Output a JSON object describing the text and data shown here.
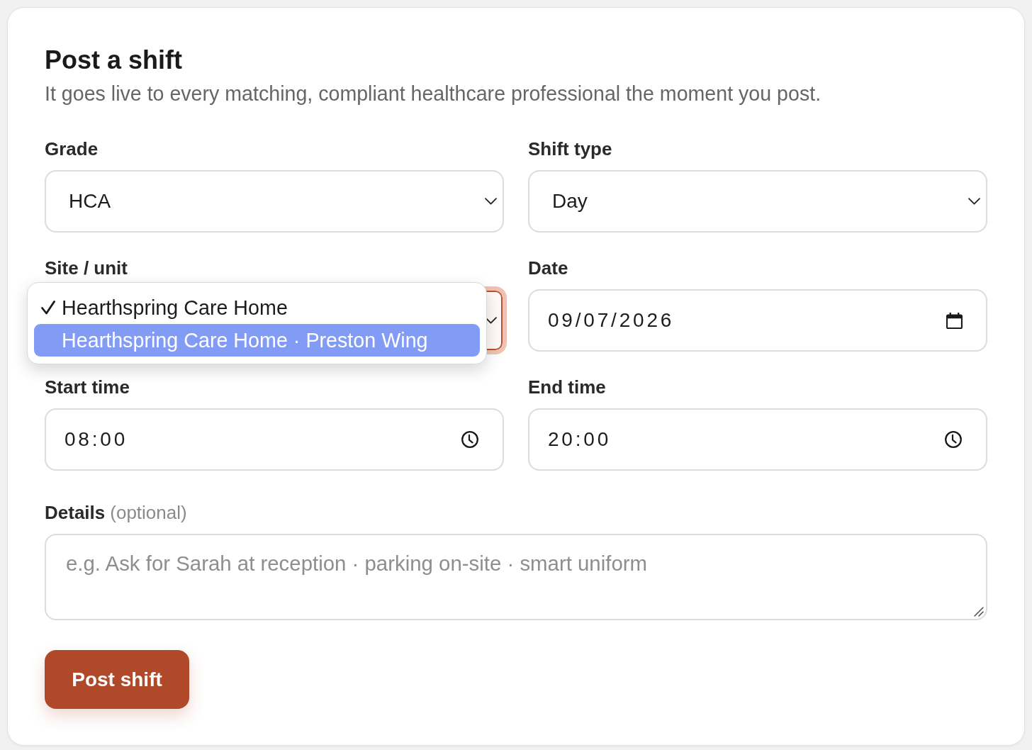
{
  "form": {
    "title": "Post a shift",
    "subtitle": "It goes live to every matching, compliant healthcare professional the moment you post.",
    "fields": [
      {
        "kind": "select",
        "label": "Grade",
        "value": "HCA",
        "focused": false,
        "open": false
      },
      {
        "kind": "select",
        "label": "Shift type",
        "value": "Day",
        "focused": false,
        "open": false
      },
      {
        "kind": "select",
        "label": "Site / unit",
        "focused": true,
        "open": true,
        "options": [
          {
            "label": "Hearthspring Care Home",
            "selected": true,
            "highlighted": false
          },
          {
            "label": "Hearthspring Care Home · Preston Wing",
            "selected": false,
            "highlighted": true
          }
        ]
      },
      {
        "kind": "date",
        "label": "Date",
        "value": "09/07/2026",
        "focused": false
      },
      {
        "kind": "time",
        "label": "Start time",
        "value": "08:00",
        "focused": false
      },
      {
        "kind": "time",
        "label": "End time",
        "value": "20:00",
        "focused": false
      },
      {
        "kind": "textarea",
        "label": "Details",
        "note": "(optional)",
        "placeholder": "e.g. Ask for Sarah at reception · parking on-site · smart uniform",
        "focused": false
      }
    ],
    "submit_button": "Post shift"
  }
}
